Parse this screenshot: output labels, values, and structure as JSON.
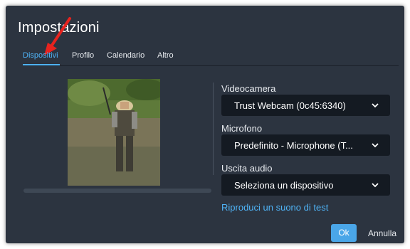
{
  "dialog": {
    "title": "Impostazioni"
  },
  "tabs": [
    {
      "label": "Dispositivi"
    },
    {
      "label": "Profilo"
    },
    {
      "label": "Calendario"
    },
    {
      "label": "Altro"
    }
  ],
  "camera": {
    "label": "Videocamera",
    "value": "Trust Webcam (0c45:6340)"
  },
  "microphone": {
    "label": "Microfono",
    "value": "Predefinito - Microphone (T..."
  },
  "audio_output": {
    "label": "Uscita audio",
    "value": "Seleziona un dispositivo"
  },
  "test_sound": {
    "label": "Riproduci un suono di test"
  },
  "buttons": {
    "ok": "Ok",
    "cancel": "Annulla"
  },
  "colors": {
    "background": "#2c3440",
    "accent": "#4fb3f6",
    "select_bg": "#141a22",
    "annotation_arrow": "#e8231e"
  },
  "icons": {
    "dropdown": "chevron-down-icon",
    "annotation": "red-arrow-icon"
  }
}
